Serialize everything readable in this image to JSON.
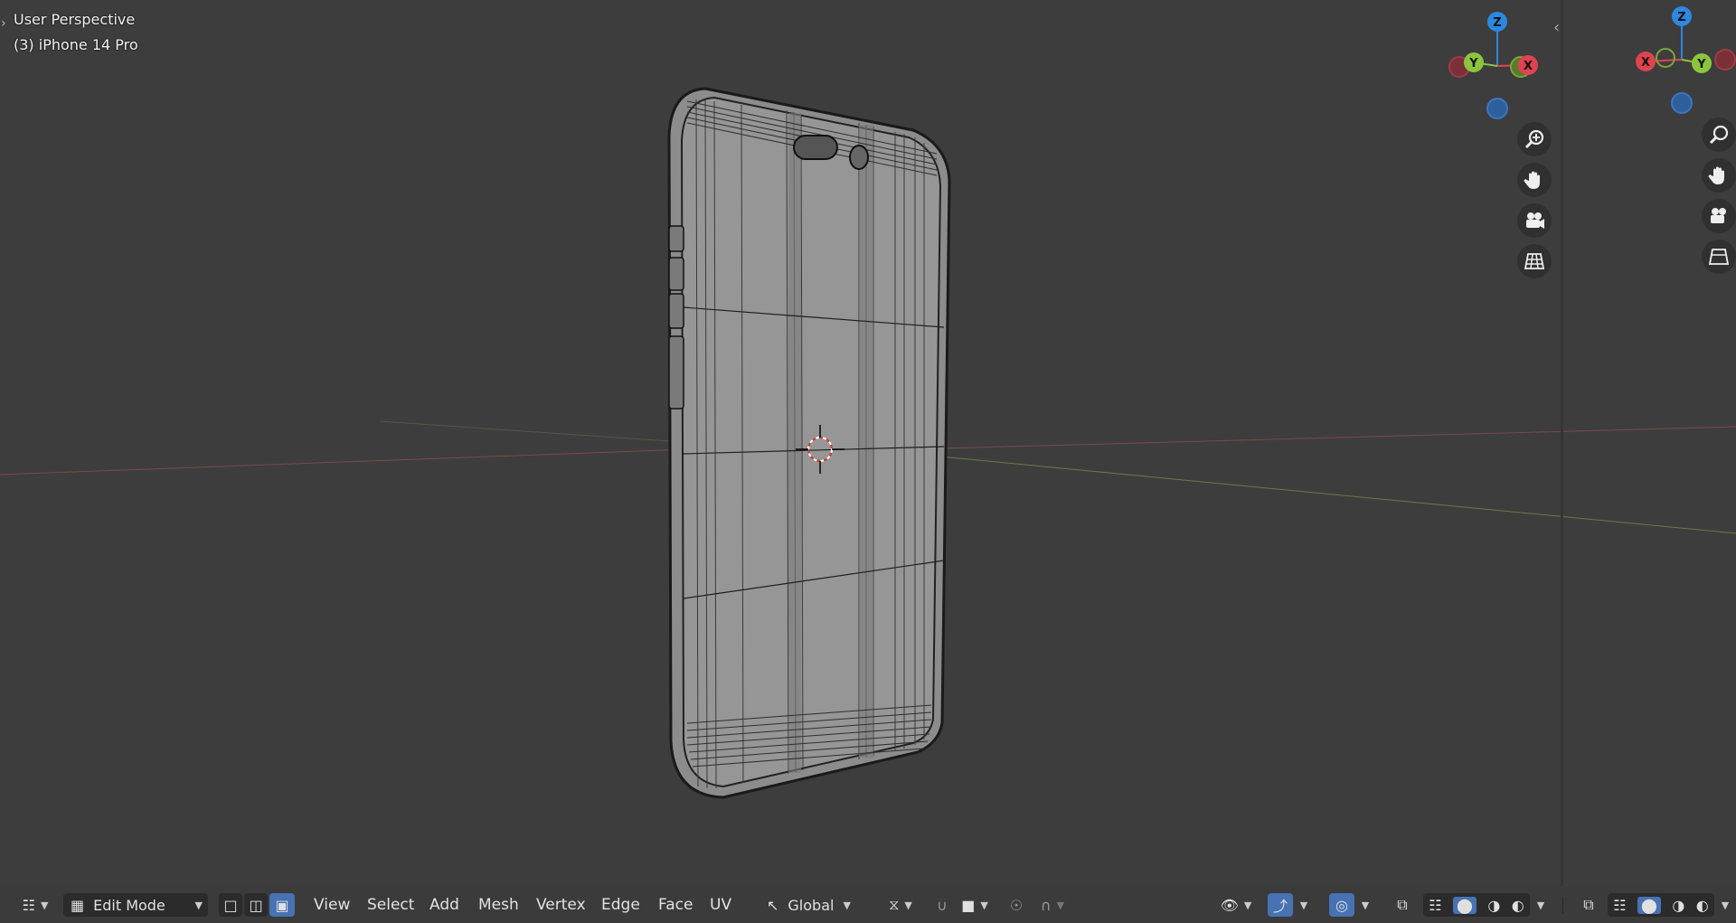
{
  "overlay": {
    "view_title": "User Perspective",
    "object_name": "(3) iPhone 14 Pro"
  },
  "gizmo": {
    "axis_z": "Z",
    "axis_y": "Y",
    "axis_x": "X",
    "colors": {
      "x": "#e0434f",
      "y": "#8bc53c",
      "z": "#2c88e0"
    }
  },
  "nav_icons": [
    "zoom-icon",
    "hand-pan-icon",
    "camera-icon",
    "grid-ortho-icon"
  ],
  "header": {
    "mode_label": "Edit Mode",
    "menus": [
      "View",
      "Select",
      "Add",
      "Mesh",
      "Vertex",
      "Edge",
      "Face",
      "UV"
    ],
    "transform_orientation": "Global",
    "select_mode_active": "face",
    "shading_active": "solid"
  }
}
